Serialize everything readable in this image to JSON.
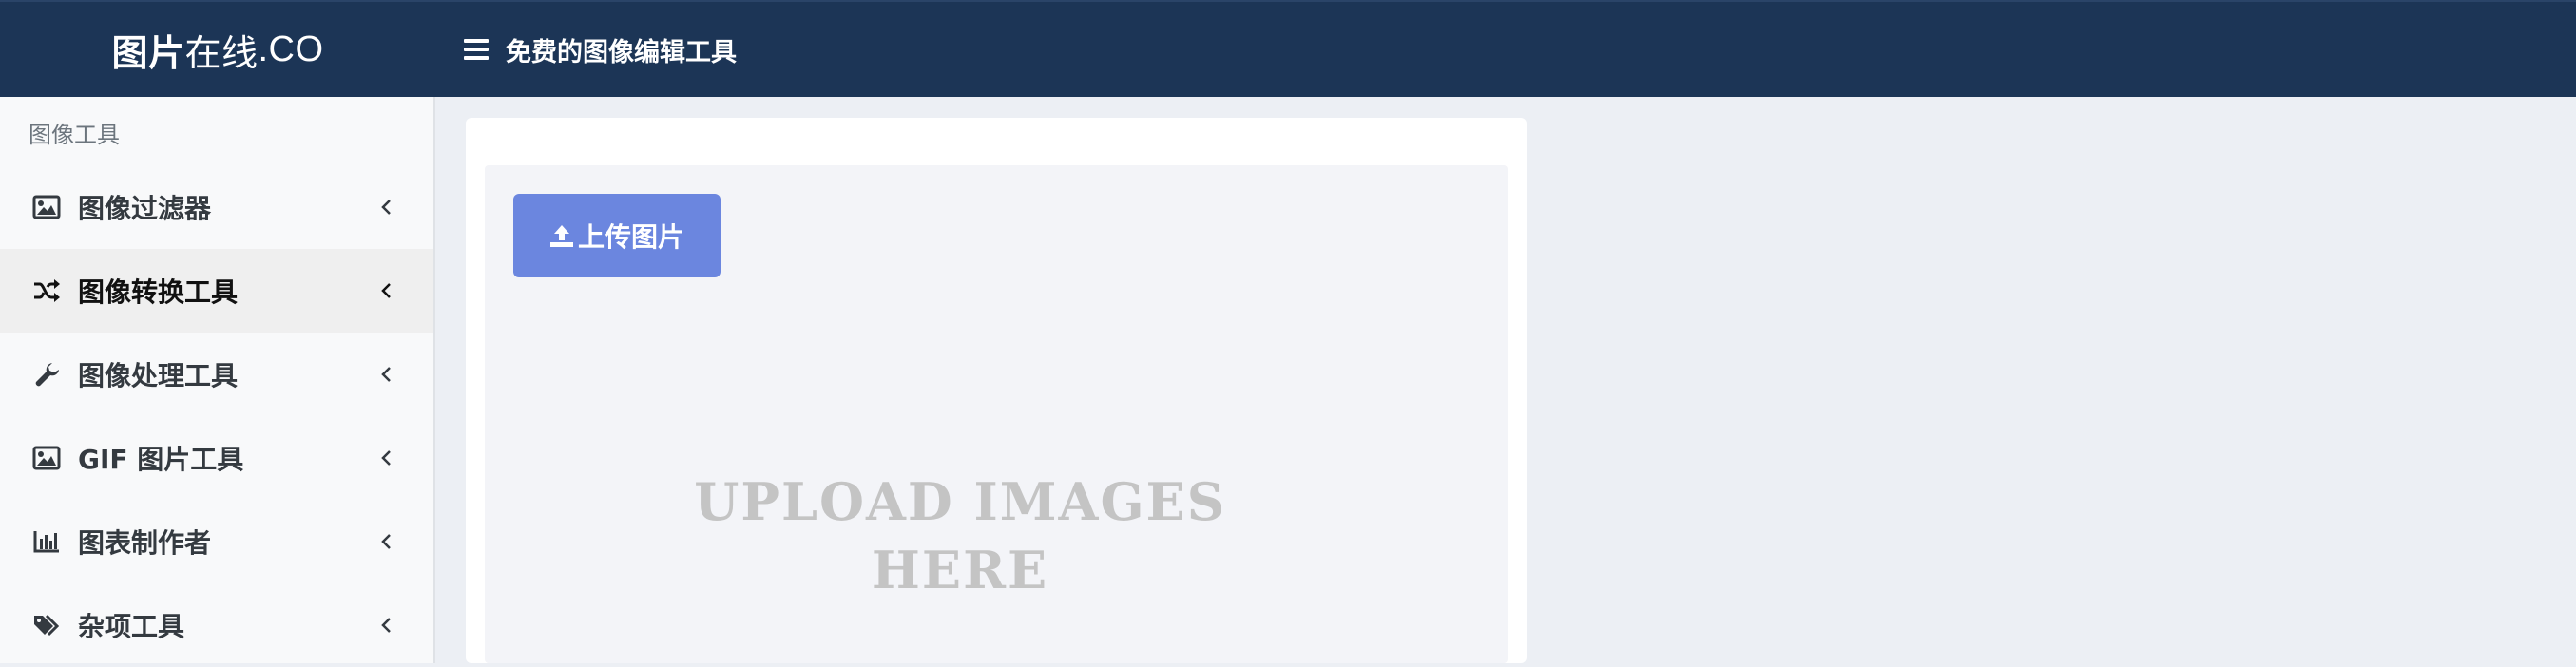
{
  "header": {
    "brand_strong": "图片",
    "brand_light": "在线",
    "brand_suffix": ".CO",
    "title": "免费的图像编辑工具",
    "menu_icon": "hamburger-icon"
  },
  "sidebar": {
    "section_title": "图像工具",
    "items": [
      {
        "label": "图像过滤器",
        "icon": "image-icon",
        "active": false
      },
      {
        "label": "图像转换工具",
        "icon": "shuffle-icon",
        "active": true
      },
      {
        "label": "图像处理工具",
        "icon": "wrench-icon",
        "active": false
      },
      {
        "label": "GIF 图片工具",
        "icon": "image-icon",
        "active": false
      },
      {
        "label": "图表制作者",
        "icon": "bar-chart-icon",
        "active": false
      },
      {
        "label": "杂项工具",
        "icon": "tags-icon",
        "active": false
      }
    ]
  },
  "main": {
    "upload_button_label": "上传图片",
    "upload_icon": "upload-icon",
    "drop_hint_line1": "UPLOAD IMAGES",
    "drop_hint_line2": "HERE"
  },
  "colors": {
    "topbar": "#1c3556",
    "sidebar_bg": "#f8f9fa",
    "active_item_bg": "#efefef",
    "page_bg": "#eceff4",
    "upload_button": "#6b86df",
    "drop_hint": "#c4c4c4"
  }
}
